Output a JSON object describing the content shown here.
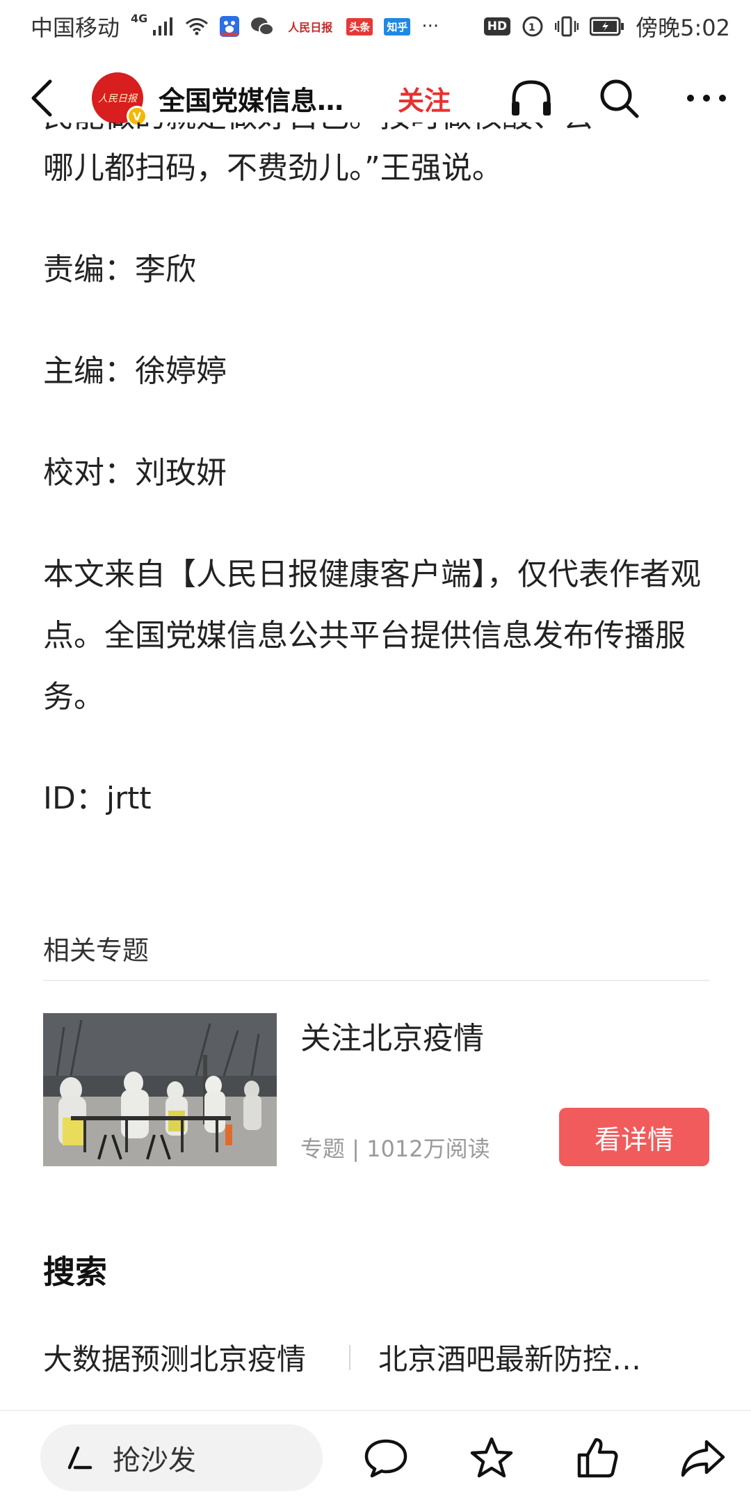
{
  "status_bar": {
    "carrier": "中国移动",
    "network": "4G",
    "apps": [
      "头条",
      "知乎"
    ],
    "peoples_app": "人民日报",
    "hd": "HD",
    "time": "傍晚5:02",
    "more": "···"
  },
  "nav": {
    "account_name": "全国党媒信息公共平台",
    "follow_label": "关注",
    "avatar_text": "人民日报"
  },
  "article": {
    "partial_line": "民能做的就是做好自己。按时做核酸、去",
    "paragraph_end": "哪儿都扫码，不费劲儿。”王强说。",
    "editor": "责编：李欣",
    "chief_editor": "主编：徐婷婷",
    "proofreader": "校对：刘玫妍",
    "source_note": "本文来自【人民日报健康客户端】，仅代表作者观点。全国党媒信息公共平台提供信息发布传播服务。",
    "id_line": "ID：jrtt"
  },
  "related": {
    "header": "相关专题",
    "topic": {
      "title": "关注北京疫情",
      "meta": "专题 | 1012万阅读",
      "button_label": "看详情"
    }
  },
  "search": {
    "title": "搜索",
    "items": [
      "大数据预测北京疫情",
      "北京酒吧最新防控措施"
    ]
  },
  "bottom_bar": {
    "comment_placeholder": "抢沙发"
  },
  "colors": {
    "accent_red": "#e8302f",
    "button_red": "#f15b5b"
  }
}
